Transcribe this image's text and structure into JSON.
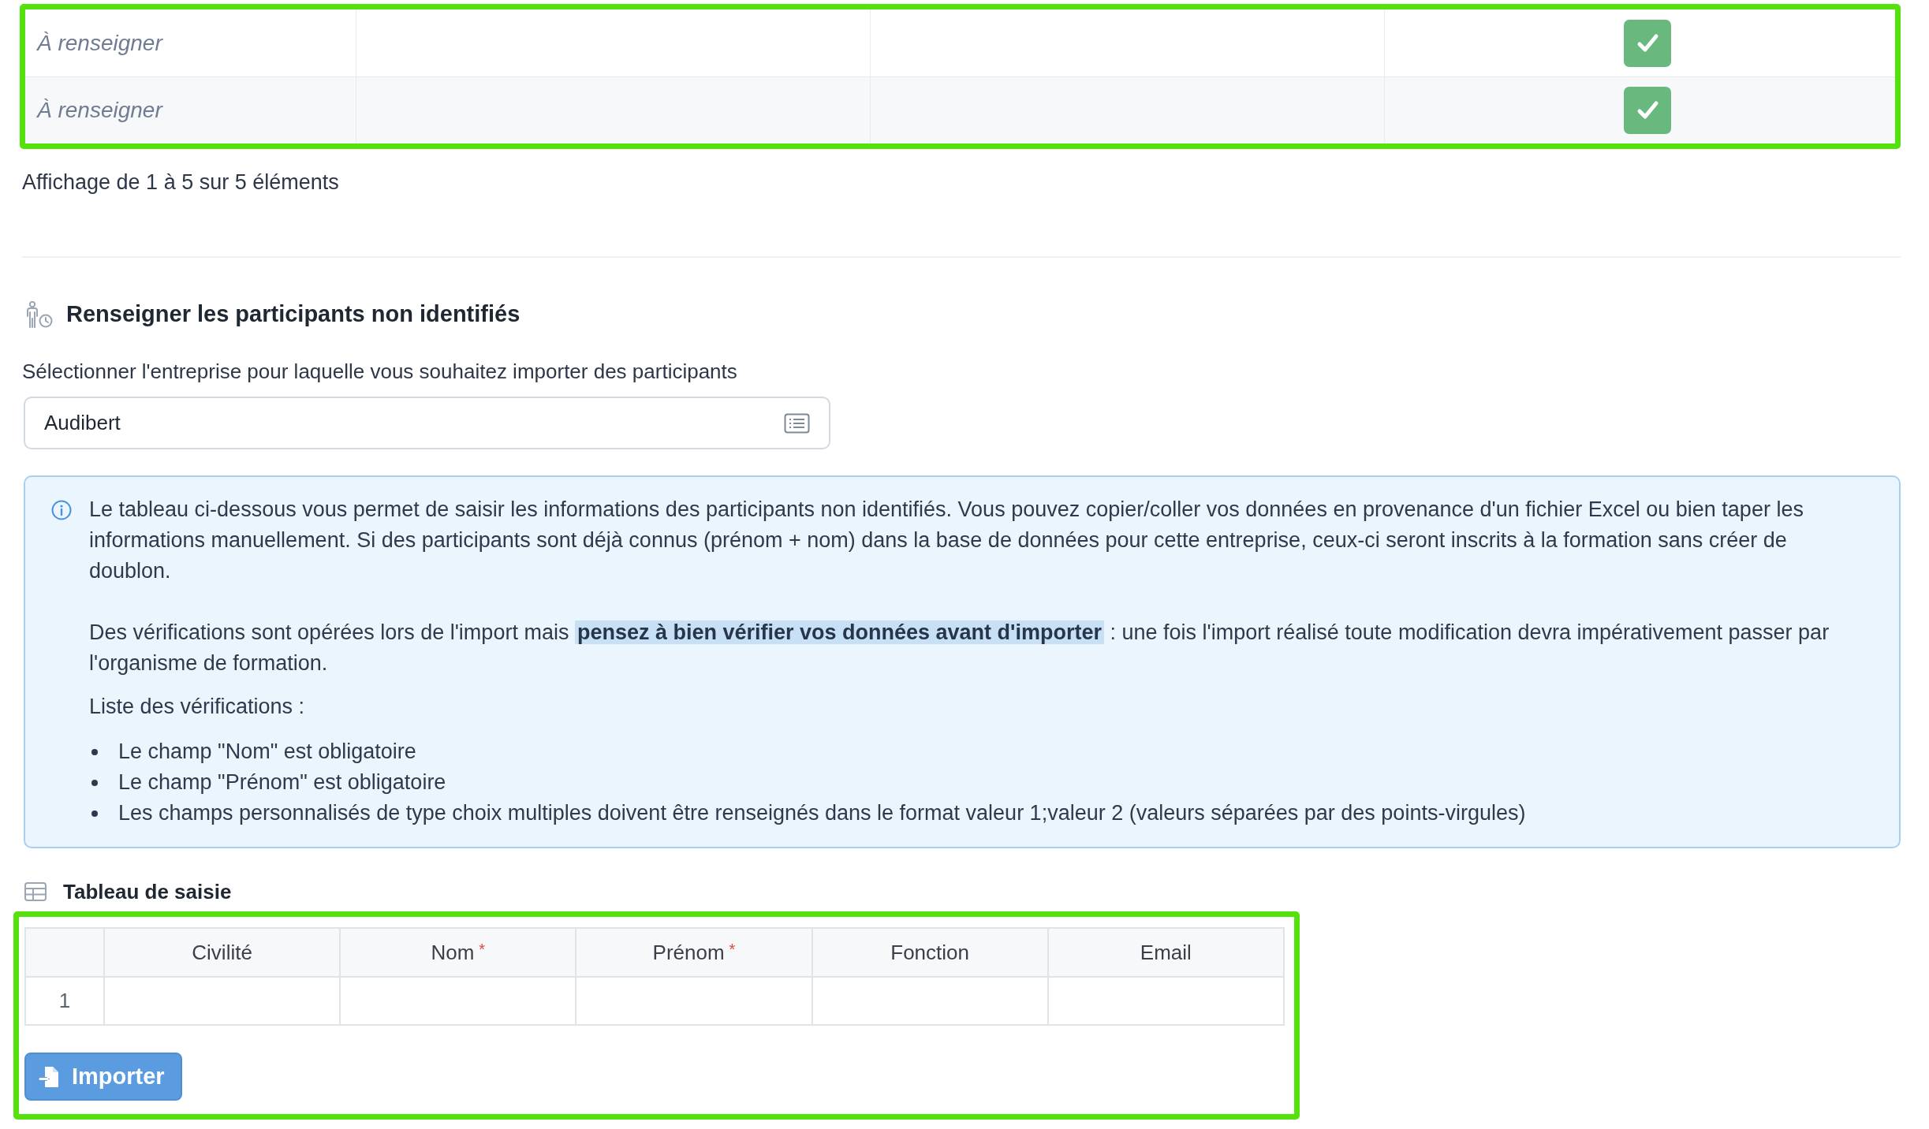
{
  "results_table": {
    "rows": [
      {
        "column_1": "À renseigner",
        "checked": true
      },
      {
        "column_1": "À renseigner",
        "checked": true
      }
    ]
  },
  "pagination_info": "Affichage de 1 à 5 sur 5 éléments",
  "unidentified_participants": {
    "title": "Renseigner les participants non identifiés",
    "company_label": "Sélectionner l'entreprise pour laquelle vous souhaitez importer des participants",
    "company_select": {
      "value": "Audibert"
    },
    "info_box": {
      "paragraphs": [
        "Le tableau ci-dessous vous permet de saisir les informations des participants non identifiés. Vous pouvez copier/coller vos données en provenance d'un fichier Excel ou bien taper les informations manuellement. Si des participants sont déjà connus (prénom + nom) dans la base de données pour cette entreprise, ceux-ci seront inscrits à la formation sans créer de doublon.",
        "Des vérifications sont opérées lors de l'import mais **pensez à bien vérifier vos données avant d'importer** : une fois l'import réalisé toute modification devra impérativement passer par l'organisme de formation."
      ],
      "list_title": "Liste des vérifications :",
      "checks": [
        "Le champ \"Nom\" est obligatoire",
        "Le champ \"Prénom\" est obligatoire",
        "Les champs personnalisés de type choix multiples doivent être renseignés dans le format valeur 1;valeur 2 (valeurs séparées par des points-virgules)"
      ]
    },
    "entry_table": {
      "title": "Tableau de saisie",
      "columns": [
        {
          "label": "Civilité"
        },
        {
          "label": "Nom",
          "required_mark": "*"
        },
        {
          "label": "Prénom",
          "required_mark": "*"
        },
        {
          "label": "Fonction"
        },
        {
          "label": "Email"
        }
      ],
      "rows": [
        {
          "number": "1"
        }
      ]
    },
    "import_button": {
      "label": "Importer"
    }
  }
}
